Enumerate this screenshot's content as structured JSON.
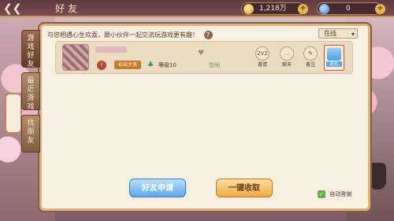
{
  "header": {
    "back_icon": "back-arrow-icon",
    "title": "好友",
    "coins": "1,218万",
    "gems": "0"
  },
  "tabs": [
    {
      "label": "游戏好友"
    },
    {
      "label": "最近游戏"
    },
    {
      "label": "找朋友"
    }
  ],
  "hint": "与您相遇心生欢喜，跟小伙伴一起交流玩游戏更有趣！",
  "status_filter": "在线",
  "friend": {
    "rank_label": "初出大侠",
    "level": "等级10",
    "presence": "空闲",
    "actions": [
      {
        "label": "2V2",
        "caption": "邀请"
      },
      {
        "label": "...",
        "caption": "聊天"
      },
      {
        "label": "✎",
        "caption": "备注"
      },
      {
        "label": "",
        "caption": "送礼"
      }
    ]
  },
  "buttons": {
    "friend_request": "好友申请",
    "collect_all": "一键收取",
    "auto_reply": "自动答谢"
  },
  "colors": {
    "accent": "#d7b57f",
    "primary_blue": "#5ea7ea",
    "orange": "#f1a945"
  }
}
